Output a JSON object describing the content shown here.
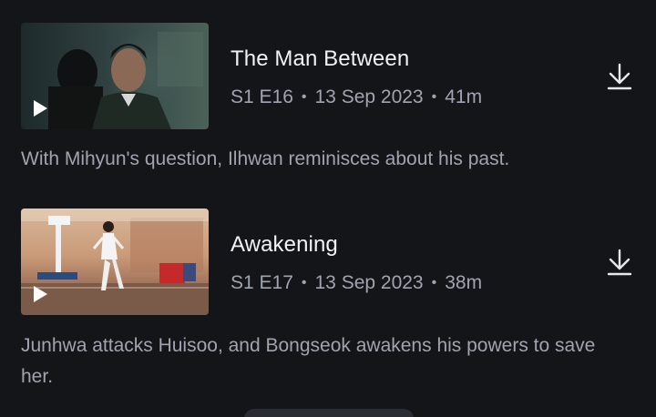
{
  "episodes": [
    {
      "title": "The Man Between",
      "episode_code": "S1 E16",
      "date": "13 Sep 2023",
      "duration": "41m",
      "separator": "•",
      "description": "With Mihyun's question, Ilhwan reminisces about his past.",
      "thumbnail_icon": "play-icon",
      "download_icon": "download-icon"
    },
    {
      "title": "Awakening",
      "episode_code": "S1 E17",
      "date": "13 Sep 2023",
      "duration": "38m",
      "separator": "•",
      "description": "Junhwa attacks Huisoo, and Bongseok awakens his powers to save her.",
      "thumbnail_icon": "play-icon",
      "download_icon": "download-icon"
    }
  ],
  "colors": {
    "background": "#141519",
    "title": "#f2f2f4",
    "secondary_text": "#a0a4b0",
    "icon": "#e8e8ec"
  }
}
